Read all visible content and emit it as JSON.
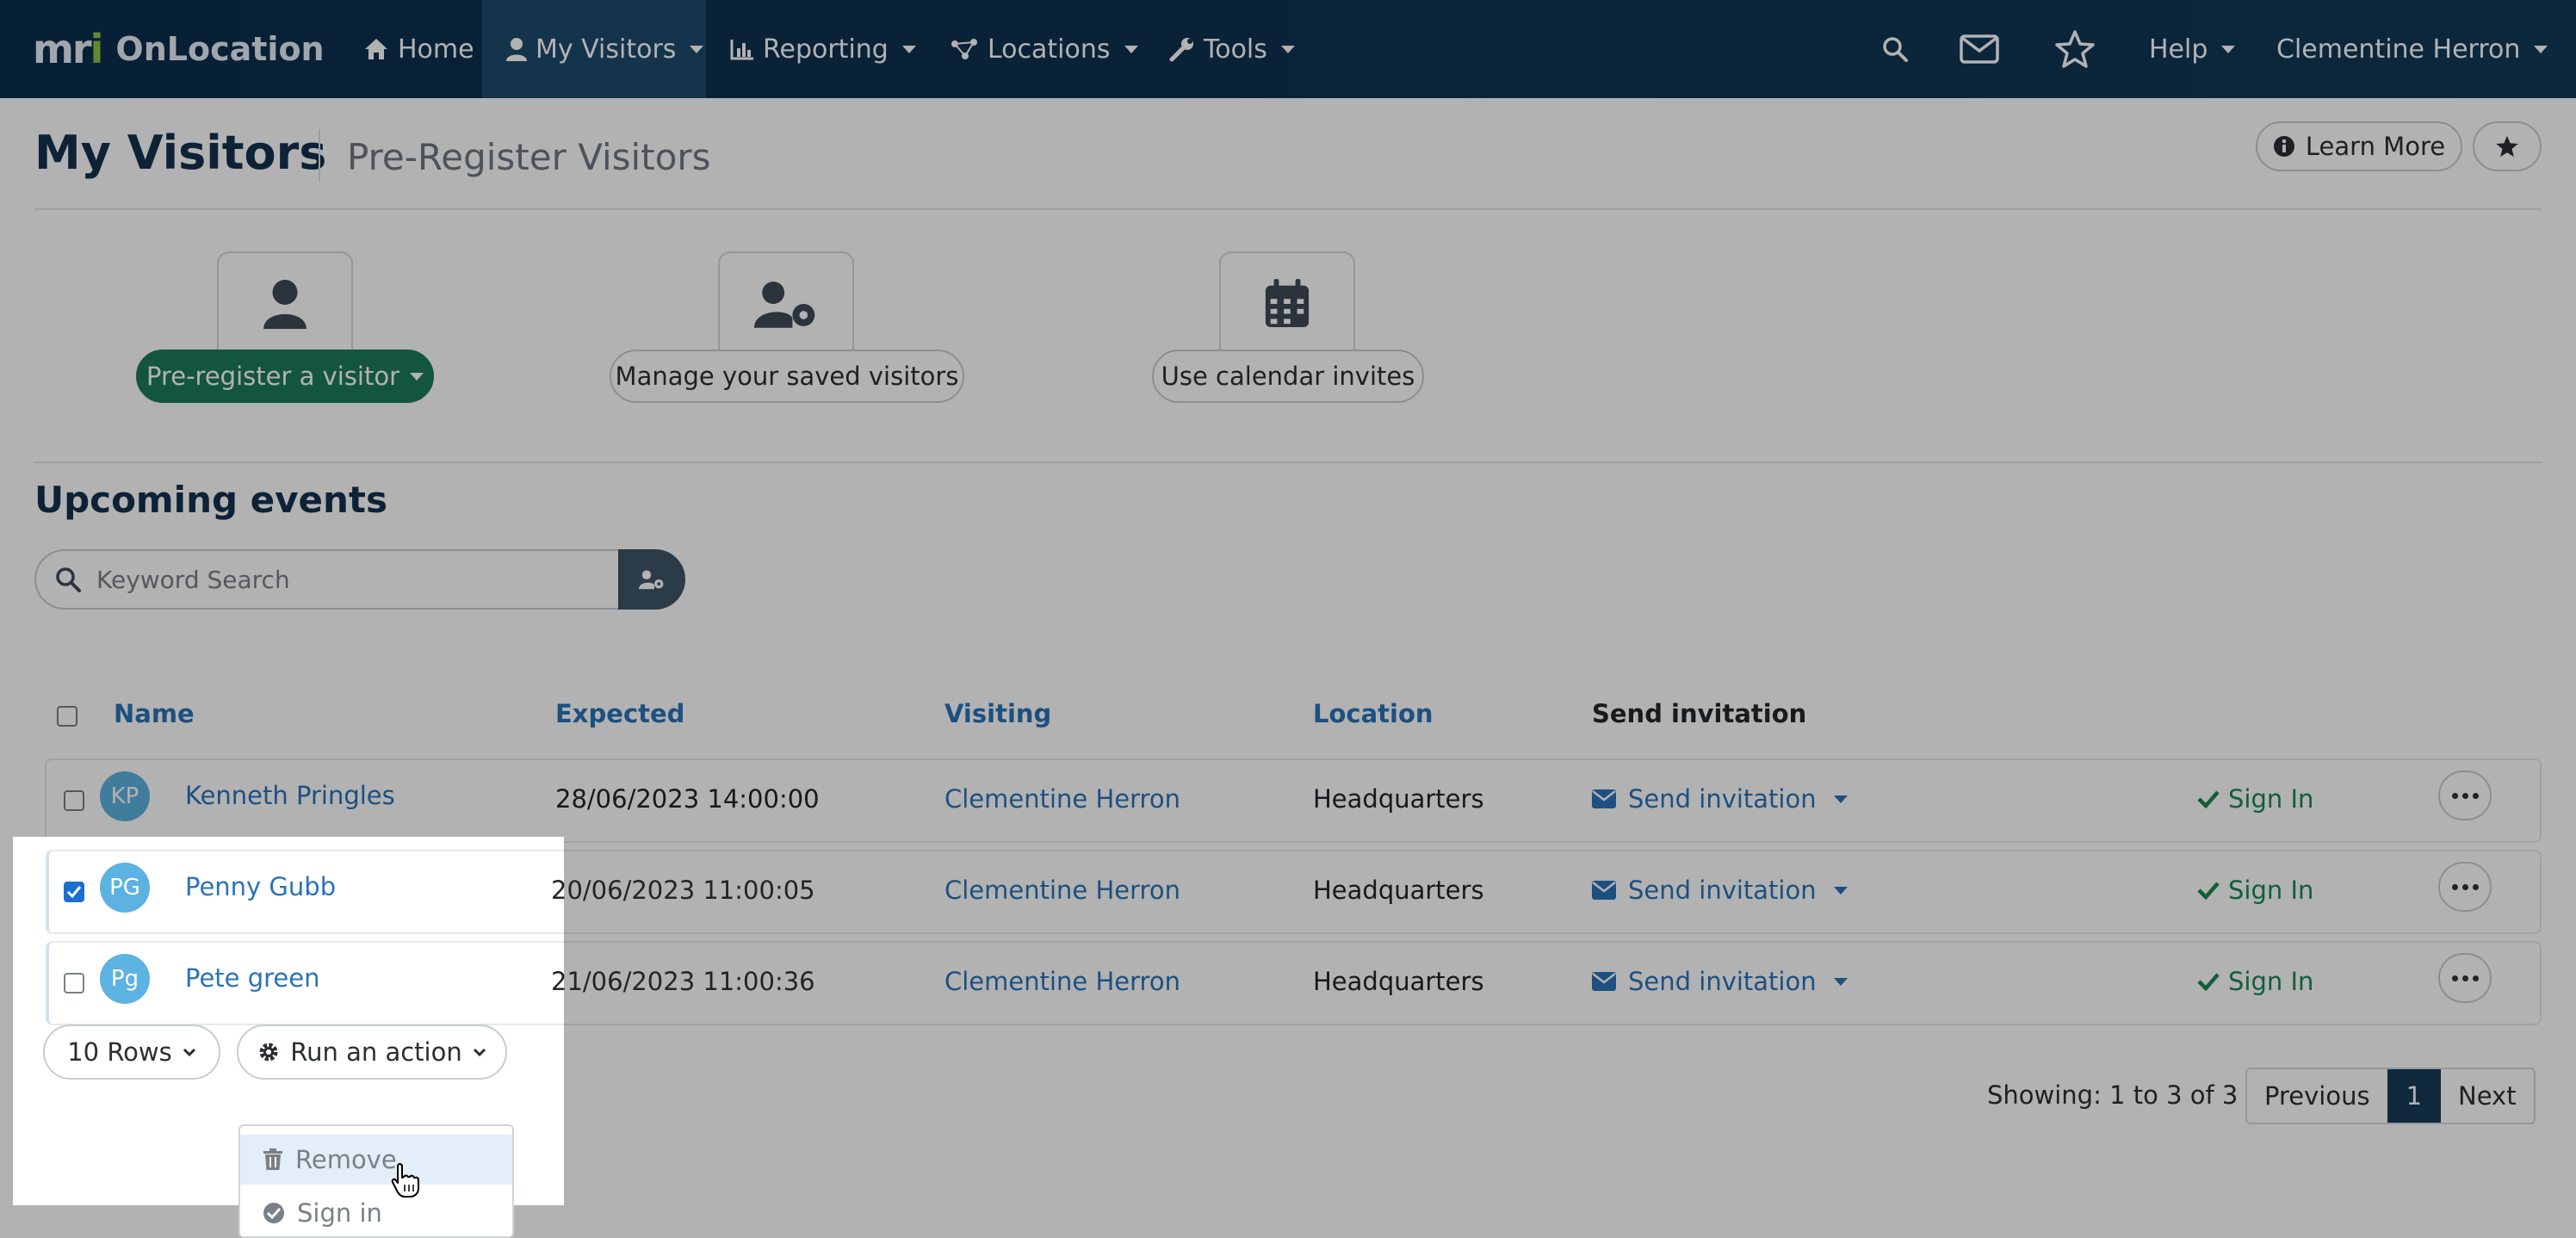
{
  "nav": {
    "brand_mark": "mri",
    "brand_name": "OnLocation",
    "items": [
      {
        "label": "Home",
        "icon": "home-icon"
      },
      {
        "label": "My Visitors",
        "icon": "user-icon",
        "active": true
      },
      {
        "label": "Reporting",
        "icon": "bar-chart-icon"
      },
      {
        "label": "Locations",
        "icon": "network-icon"
      },
      {
        "label": "Tools",
        "icon": "wrench-icon"
      }
    ],
    "help_label": "Help",
    "user_name": "Clementine Herron",
    "icons": [
      "search-icon",
      "envelope-icon",
      "star-icon"
    ]
  },
  "page": {
    "title": "My Visitors",
    "subtitle": "Pre-Register Visitors",
    "learn_more_label": "Learn More"
  },
  "tiles": [
    {
      "label": "Pre-register a visitor",
      "icon": "user-icon"
    },
    {
      "label": "Manage your saved visitors",
      "icon": "user-gear-icon"
    },
    {
      "label": "Use calendar invites",
      "icon": "calendar-icon"
    }
  ],
  "events": {
    "title": "Upcoming events",
    "search_placeholder": "Keyword Search",
    "columns": [
      "Name",
      "Expected",
      "Visiting",
      "Location",
      "Send invitation"
    ],
    "rows": [
      {
        "initials": "KP",
        "name": "Kenneth Pringles",
        "expected": "28/06/2023 14:00:00",
        "visiting": "Clementine Herron",
        "location": "Headquarters",
        "invite": "Send invitation",
        "action": "Sign In",
        "checked": false
      },
      {
        "initials": "PG",
        "name": "Penny Gubb",
        "expected": "20/06/2023 11:00:05",
        "visiting": "Clementine Herron",
        "location": "Headquarters",
        "invite": "Send invitation",
        "action": "Sign In",
        "checked": true
      },
      {
        "initials": "Pg",
        "name": "Pete green",
        "expected": "21/06/2023 11:00:36",
        "visiting": "Clementine Herron",
        "location": "Headquarters",
        "invite": "Send invitation",
        "action": "Sign In",
        "checked": false
      }
    ]
  },
  "footer": {
    "rows_label": "10 Rows",
    "action_label": "Run an action",
    "action_menu": [
      "Remove",
      "Sign in"
    ],
    "showing": "Showing: 1 to 3 of 3",
    "prev": "Previous",
    "page": "1",
    "next": "Next"
  },
  "colors": {
    "nav_bg": "#0b2f4e",
    "primary_green": "#1e7a5c",
    "link_blue": "#2a73b8",
    "success_green": "#198754",
    "title_navy": "#14324f"
  }
}
